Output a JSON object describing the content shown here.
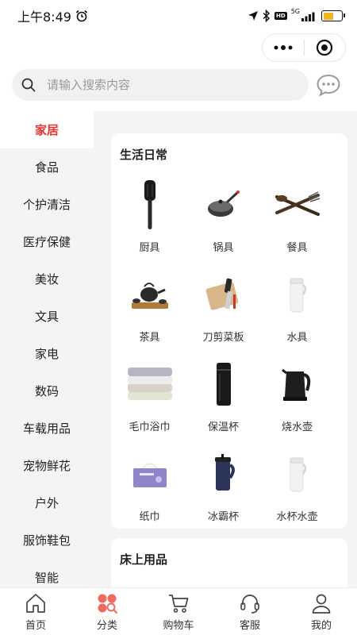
{
  "status_bar": {
    "time": "上午8:49",
    "hd": "HD",
    "network": "5G"
  },
  "search": {
    "placeholder": "请输入搜索内容"
  },
  "categories": [
    {
      "label": "家居",
      "active": true
    },
    {
      "label": "食品"
    },
    {
      "label": "个护清洁"
    },
    {
      "label": "医疗保健"
    },
    {
      "label": "美妆"
    },
    {
      "label": "文具"
    },
    {
      "label": "家电"
    },
    {
      "label": "数码"
    },
    {
      "label": "车载用品"
    },
    {
      "label": "宠物鲜花"
    },
    {
      "label": "户外"
    },
    {
      "label": "服饰鞋包"
    },
    {
      "label": "智能"
    }
  ],
  "section_main": {
    "title": "生活日常",
    "items": [
      {
        "label": "厨具",
        "icon": "spatula-icon"
      },
      {
        "label": "锅具",
        "icon": "wok-icon"
      },
      {
        "label": "餐具",
        "icon": "cutlery-icon"
      },
      {
        "label": "茶具",
        "icon": "tea-set-icon"
      },
      {
        "label": "刀剪菜板",
        "icon": "cutting-board-icon"
      },
      {
        "label": "水具",
        "icon": "water-bottle-icon"
      },
      {
        "label": "毛巾浴巾",
        "icon": "towel-icon"
      },
      {
        "label": "保温杯",
        "icon": "thermos-icon"
      },
      {
        "label": "烧水壶",
        "icon": "kettle-icon"
      },
      {
        "label": "纸巾",
        "icon": "tissue-icon"
      },
      {
        "label": "冰霸杯",
        "icon": "tumbler-icon"
      },
      {
        "label": "水杯水壶",
        "icon": "water-cup-icon"
      }
    ]
  },
  "section_second": {
    "title": "床上用品"
  },
  "tab_bar": [
    {
      "label": "首页",
      "icon": "home-icon"
    },
    {
      "label": "分类",
      "icon": "category-icon",
      "active": true
    },
    {
      "label": "购物车",
      "icon": "cart-icon"
    },
    {
      "label": "客服",
      "icon": "headset-icon"
    },
    {
      "label": "我的",
      "icon": "user-icon"
    }
  ],
  "colors": {
    "accent": "#e5342e",
    "nav_bg": "#f4f4f4",
    "battery": "#f3b321"
  }
}
